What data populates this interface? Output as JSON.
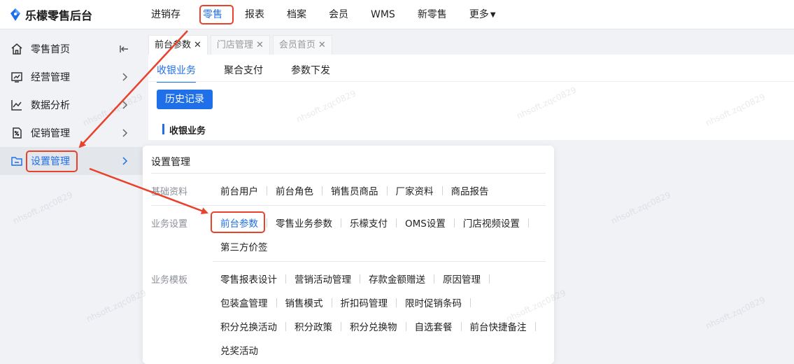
{
  "brand": {
    "name": "乐檬零售后台"
  },
  "topnav": {
    "items": [
      {
        "label": "进销存"
      },
      {
        "label": "零售"
      },
      {
        "label": "报表"
      },
      {
        "label": "档案"
      },
      {
        "label": "会员"
      },
      {
        "label": "WMS"
      },
      {
        "label": "新零售"
      },
      {
        "label": "更多"
      }
    ],
    "active": "零售"
  },
  "sidebar": {
    "items": [
      {
        "label": "零售首页",
        "icon": "home-icon"
      },
      {
        "label": "经营管理",
        "icon": "chart-board-icon"
      },
      {
        "label": "数据分析",
        "icon": "line-chart-icon"
      },
      {
        "label": "促销管理",
        "icon": "promo-tag-icon"
      },
      {
        "label": "设置管理",
        "icon": "folder-icon"
      }
    ],
    "active": "设置管理"
  },
  "tabs": [
    {
      "label": "前台参数",
      "active": true
    },
    {
      "label": "门店管理",
      "active": false
    },
    {
      "label": "会员首页",
      "active": false
    }
  ],
  "subtabs": [
    {
      "label": "收银业务",
      "active": true
    },
    {
      "label": "聚合支付",
      "active": false
    },
    {
      "label": "参数下发",
      "active": false
    }
  ],
  "main": {
    "history_button": "历史记录",
    "section_title": "收银业务"
  },
  "flyout": {
    "title": "设置管理",
    "groups": [
      {
        "label": "基础资料",
        "rows": [
          [
            "前台用户",
            "前台角色",
            "销售员商品",
            "厂家资料",
            "商品报告"
          ]
        ]
      },
      {
        "label": "业务设置",
        "rows": [
          [
            "前台参数",
            "零售业务参数",
            "乐檬支付",
            "OMS设置",
            "门店视频设置"
          ],
          [
            "第三方价签"
          ]
        ]
      },
      {
        "label": "业务模板",
        "rows": [
          [
            "零售报表设计",
            "营销活动管理",
            "存款金额赠送",
            "原因管理"
          ],
          [
            "包装盒管理",
            "销售模式",
            "折扣码管理",
            "限时促销条码"
          ],
          [
            "积分兑换活动",
            "积分政策",
            "积分兑换物",
            "自选套餐",
            "前台快捷备注"
          ],
          [
            "兑奖活动"
          ]
        ]
      }
    ],
    "active_item": "前台参数"
  },
  "watermark": "nhsoft.zqc0829",
  "colors": {
    "accent": "#1f6fe8",
    "highlight": "#e8412c"
  }
}
